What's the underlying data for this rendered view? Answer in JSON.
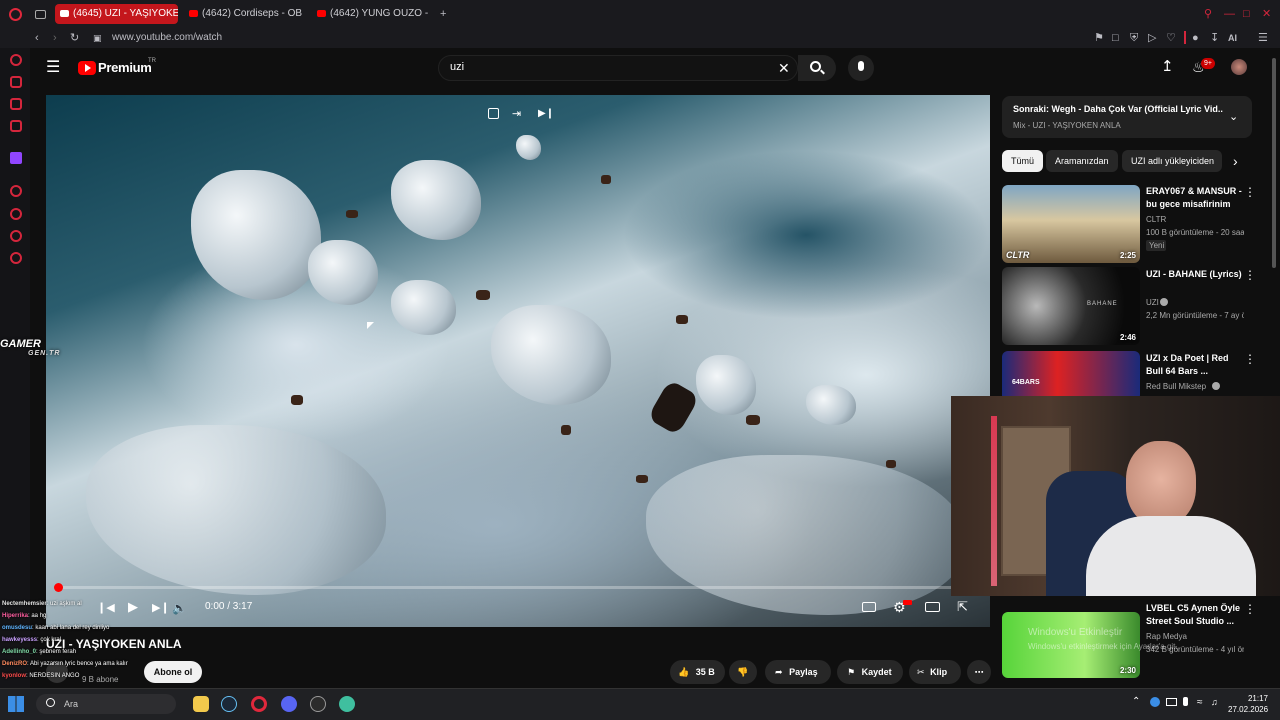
{
  "browser": {
    "tabs": [
      {
        "label": "(4645) UZI - YAŞIYOKEN A"
      },
      {
        "label": "(4642) Cordiseps - OBUR"
      },
      {
        "label": "(4642) YUNG OUZO - 7/2"
      }
    ],
    "url": "www.youtube.com/watch",
    "chrome_icons": [
      "back-icon",
      "forward-icon",
      "reload-icon",
      "lock-icon"
    ],
    "ai_label": "AI"
  },
  "youtube": {
    "logo_text": "Premium",
    "logo_badge": "TR",
    "search_value": "uzi",
    "notification_count": "9+"
  },
  "player": {
    "time_text": "0:00 / 3:17",
    "progress_fraction": 0.0
  },
  "video": {
    "title": "UZI - YAŞIYOKEN ANLA",
    "subscribers": "9 B abone",
    "subscribe_label": "Abone ol",
    "like_count": "35 B",
    "share_label": "Paylaş",
    "save_label": "Kaydet",
    "clip_label": "Klip"
  },
  "sidebar": {
    "next_title": "Sonraki: Wegh - Daha Çok Var (Official Lyric Vid...",
    "next_sub": "Mix - UZI - YAŞIYOKEN ANLA",
    "chips": [
      "Tümü",
      "Aramanızdan",
      "UZI adlı yükleyiciden"
    ],
    "recommendations": [
      {
        "title": "ERAY067 & MANSUR - bu gece misafirinim",
        "channel": "CLTR",
        "meta": "100 B görüntüleme - 20 saat...",
        "badge": "Yeni",
        "duration": "2:25",
        "thumb_label": "CLTR"
      },
      {
        "title": "UZI - BAHANE (Lyrics)",
        "channel": "UZI",
        "meta": "2,2 Mn görüntüleme - 7 ay ö...",
        "duration": "2:46",
        "thumb_label": "BAHANE"
      },
      {
        "title": "UZI x Da Poet | Red Bull 64 Bars ...",
        "channel": "Red Bull Mikstep",
        "meta": "",
        "duration": "",
        "thumb_label": "64BARS"
      },
      {
        "title": "LVBEL C5 Aynen Öyle Street Soul Studio ...",
        "channel": "Rap Medya",
        "meta": "342 B görüntüleme - 4 yıl ön...",
        "duration": "2:30",
        "thumb_label": ""
      }
    ]
  },
  "overlay": {
    "gamer_logo": "GAMER",
    "gamer_sub": "GEN.TR",
    "watermark_line1": "Windows'u Etkinleştir",
    "watermark_line2": "Windows'u etkinleştirmek için Ayarlar'a git."
  },
  "chat": [
    {
      "nick": "Nectemhemsier",
      "text": ": uzi aşkım al"
    },
    {
      "nick": "Hiperrika",
      "text": ": aa hg"
    },
    {
      "nick": "omusdesu",
      "text": ": kaan abi lana del rey dinliyo"
    },
    {
      "nick": "hawkeyesss",
      "text": ": çok kral"
    },
    {
      "nick": "Adellinho_0",
      "text": ": şebnem ferah"
    },
    {
      "nick": "DenizRO",
      "text": ": Abi yazarsın lyric bence ya ama kalır"
    },
    {
      "nick": "kyonlow",
      "text": ": NERDESIN ANGO"
    }
  ],
  "taskbar": {
    "search_placeholder": "Ara",
    "time": "21:17",
    "date": "27.02.2026"
  }
}
